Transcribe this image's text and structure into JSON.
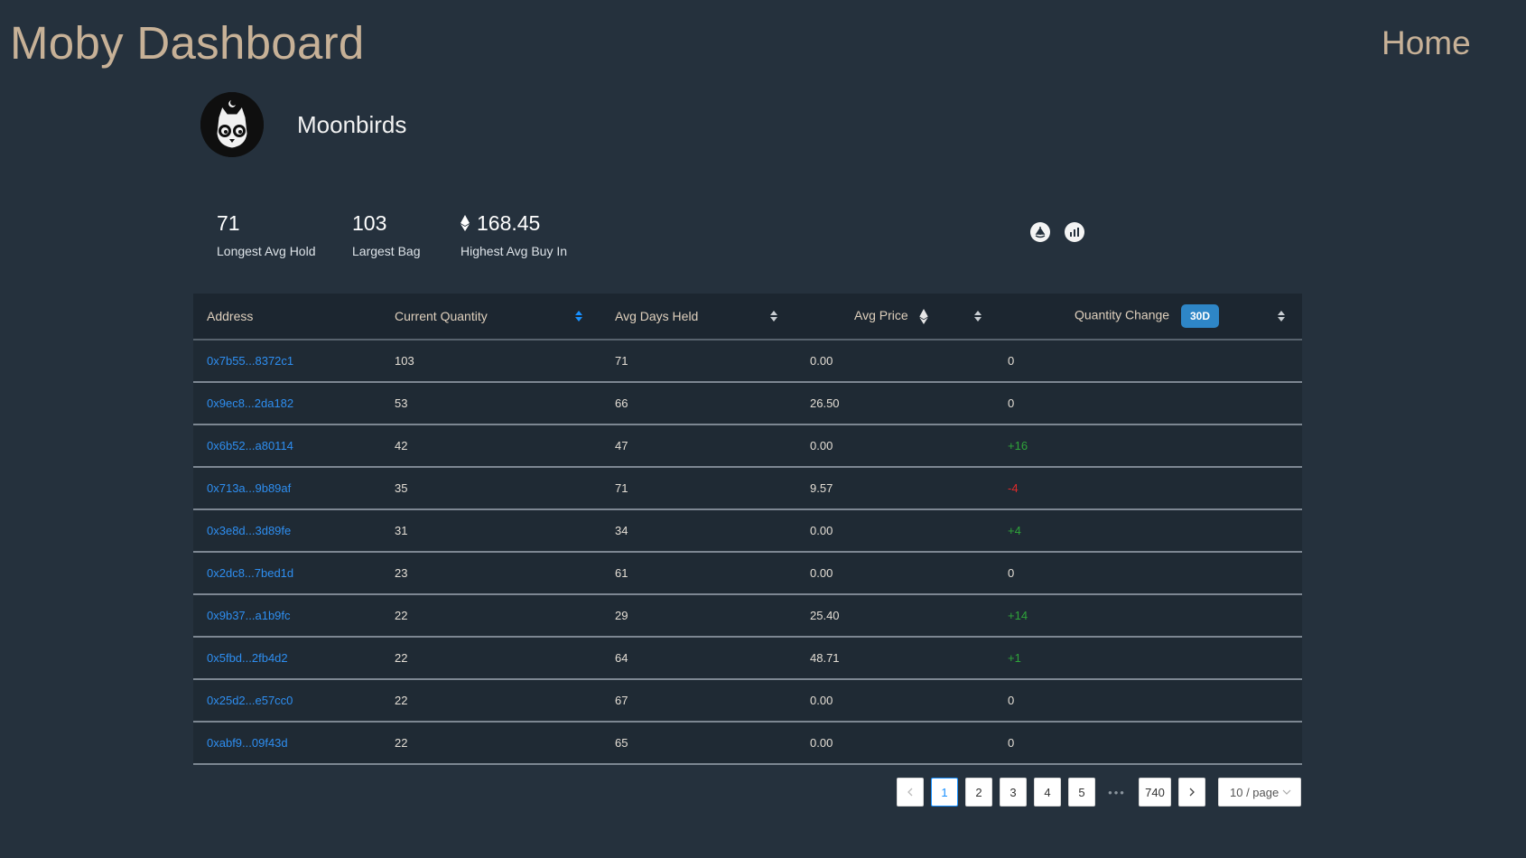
{
  "header": {
    "app_title": "Moby Dashboard",
    "home_label": "Home"
  },
  "collection": {
    "name": "Moonbirds",
    "avatar_icon": "moonbird-owl-avatar"
  },
  "stats": [
    {
      "value": "71",
      "label": "Longest Avg Hold",
      "icon": ""
    },
    {
      "value": "103",
      "label": "Largest Bag",
      "icon": ""
    },
    {
      "value": "168.45",
      "label": "Highest Avg Buy In",
      "icon": "ethereum-icon"
    }
  ],
  "links": [
    {
      "icon": "opensea-icon"
    },
    {
      "icon": "chart-icon"
    }
  ],
  "table": {
    "columns": [
      {
        "label": "Address"
      },
      {
        "label": "Current Quantity"
      },
      {
        "label": "Avg Days Held"
      },
      {
        "label": "Avg Price"
      },
      {
        "label": "Quantity Change",
        "badge": "30D"
      }
    ],
    "rows": [
      {
        "address": "0x7b55...8372c1",
        "quantity": "103",
        "days": "71",
        "price": "0.00",
        "change": "0",
        "trend": "neutral"
      },
      {
        "address": "0x9ec8...2da182",
        "quantity": "53",
        "days": "66",
        "price": "26.50",
        "change": "0",
        "trend": "neutral"
      },
      {
        "address": "0x6b52...a80114",
        "quantity": "42",
        "days": "47",
        "price": "0.00",
        "change": "+16",
        "trend": "up"
      },
      {
        "address": "0x713a...9b89af",
        "quantity": "35",
        "days": "71",
        "price": "9.57",
        "change": "-4",
        "trend": "down"
      },
      {
        "address": "0x3e8d...3d89fe",
        "quantity": "31",
        "days": "34",
        "price": "0.00",
        "change": "+4",
        "trend": "up"
      },
      {
        "address": "0x2dc8...7bed1d",
        "quantity": "23",
        "days": "61",
        "price": "0.00",
        "change": "0",
        "trend": "neutral"
      },
      {
        "address": "0x9b37...a1b9fc",
        "quantity": "22",
        "days": "29",
        "price": "25.40",
        "change": "+14",
        "trend": "up"
      },
      {
        "address": "0x5fbd...2fb4d2",
        "quantity": "22",
        "days": "64",
        "price": "48.71",
        "change": "+1",
        "trend": "up"
      },
      {
        "address": "0x25d2...e57cc0",
        "quantity": "22",
        "days": "67",
        "price": "0.00",
        "change": "0",
        "trend": "neutral"
      },
      {
        "address": "0xabf9...09f43d",
        "quantity": "22",
        "days": "65",
        "price": "0.00",
        "change": "0",
        "trend": "neutral"
      }
    ]
  },
  "pagination": {
    "pages": [
      "1",
      "2",
      "3",
      "4",
      "5"
    ],
    "current": "1",
    "ellipsis": "•••",
    "last_page": "740",
    "page_size": "10 / page"
  },
  "colors": {
    "background": "#25313d",
    "title": "#c7b197",
    "link": "#2e8ef0",
    "positive": "#2fa43a",
    "negative": "#e02a2a",
    "badge": "#2e86c7"
  }
}
